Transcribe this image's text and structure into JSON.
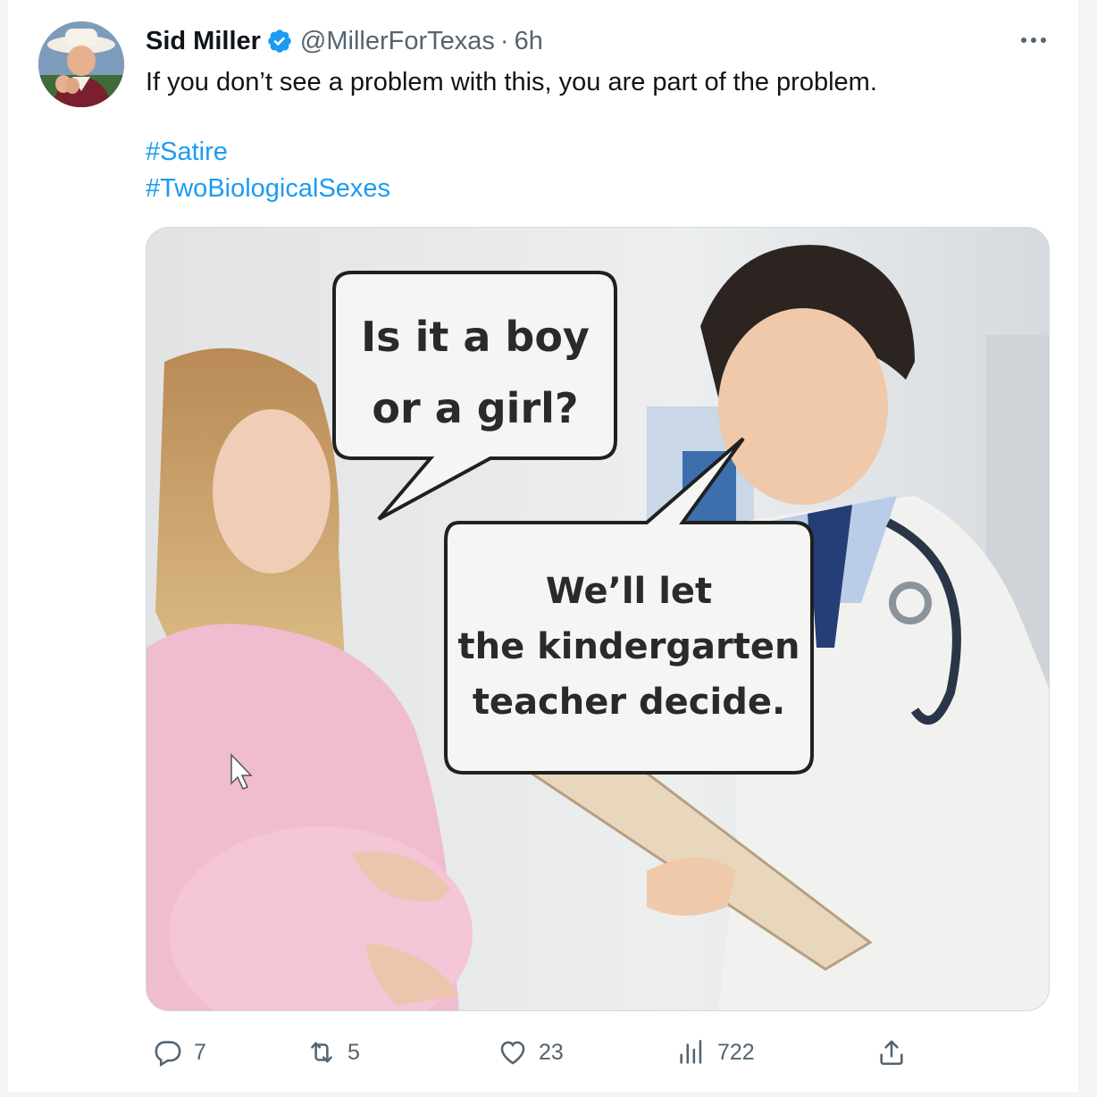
{
  "tweet": {
    "author_name": "Sid Miller",
    "handle": "@MillerForTexas",
    "separator": "·",
    "time": "6h",
    "text": "If you don’t see a problem with this, you are part of the problem.",
    "hashtags": [
      "#Satire",
      "#TwoBiologicalSexes"
    ]
  },
  "media": {
    "bubble_1_line_1": "Is it a boy",
    "bubble_1_line_2": "or a girl?",
    "bubble_2_line_1": "We’ll let",
    "bubble_2_line_2": "the kindergarten",
    "bubble_2_line_3": "teacher decide."
  },
  "actions": {
    "replies": "7",
    "retweets": "5",
    "likes": "23",
    "views": "722"
  },
  "icons": {
    "verified": "verified-badge-icon",
    "more": "more-icon",
    "reply": "reply-icon",
    "retweet": "retweet-icon",
    "like": "heart-icon",
    "views": "views-icon",
    "share": "share-icon"
  },
  "colors": {
    "link": "#1d9bf0",
    "secondary_text": "#536471",
    "verified": "#1d9bf0"
  }
}
